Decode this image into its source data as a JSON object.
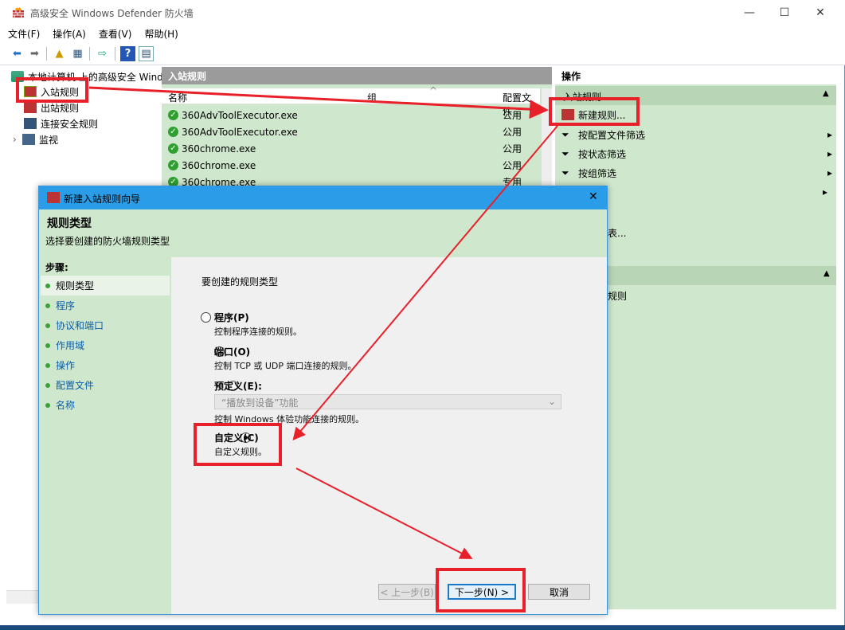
{
  "window": {
    "title": "高级安全 Windows Defender 防火墙",
    "min": "—",
    "max": "☐",
    "close": "✕"
  },
  "menu": [
    "文件(F)",
    "操作(A)",
    "查看(V)",
    "帮助(H)"
  ],
  "tree": {
    "root": "本地计算机 上的高级安全 Wind",
    "items": [
      "入站规则",
      "出站规则",
      "连接安全规则",
      "监视"
    ]
  },
  "middle": {
    "header": "入站规则",
    "columns": [
      "名称",
      "组",
      "配置文件"
    ],
    "rows": [
      {
        "name": "360AdvToolExecutor.exe",
        "profile": "公用"
      },
      {
        "name": "360AdvToolExecutor.exe",
        "profile": "公用"
      },
      {
        "name": "360chrome.exe",
        "profile": "公用"
      },
      {
        "name": "360chrome.exe",
        "profile": "公用"
      },
      {
        "name": "360chrome.exe",
        "profile": "专用"
      }
    ]
  },
  "actions": {
    "header": "操作",
    "section": "入站规则",
    "items": [
      "新建规则...",
      "按配置文件筛选",
      "按状态筛选",
      "按组筛选"
    ],
    "partial1": "表...",
    "partial2": "规则"
  },
  "dialog": {
    "title": "新建入站规则向导",
    "heading": "规则类型",
    "subheading": "选择要创建的防火墙规则类型",
    "steps_label": "步骤:",
    "steps": [
      "规则类型",
      "程序",
      "协议和端口",
      "作用域",
      "操作",
      "配置文件",
      "名称"
    ],
    "question": "要创建的规则类型",
    "options": [
      {
        "label": "程序(P)",
        "desc": "控制程序连接的规则。",
        "selected": false
      },
      {
        "label": "端口(O)",
        "desc": "控制 TCP 或 UDP 端口连接的规则。",
        "selected": false
      },
      {
        "label": "预定义(E):",
        "desc": "控制 Windows 体验功能连接的规则。",
        "selected": false
      },
      {
        "label": "自定义(C)",
        "desc": "自定义规则。",
        "selected": true
      }
    ],
    "predefined_value": "“播放到设备”功能",
    "buttons": {
      "back": "< 上一步(B)",
      "next": "下一步(N) >",
      "cancel": "取消"
    }
  },
  "colors": {
    "highlight": "#e8202a",
    "pane_green": "#cfe7cd",
    "title_blue": "#2b9ce8"
  }
}
